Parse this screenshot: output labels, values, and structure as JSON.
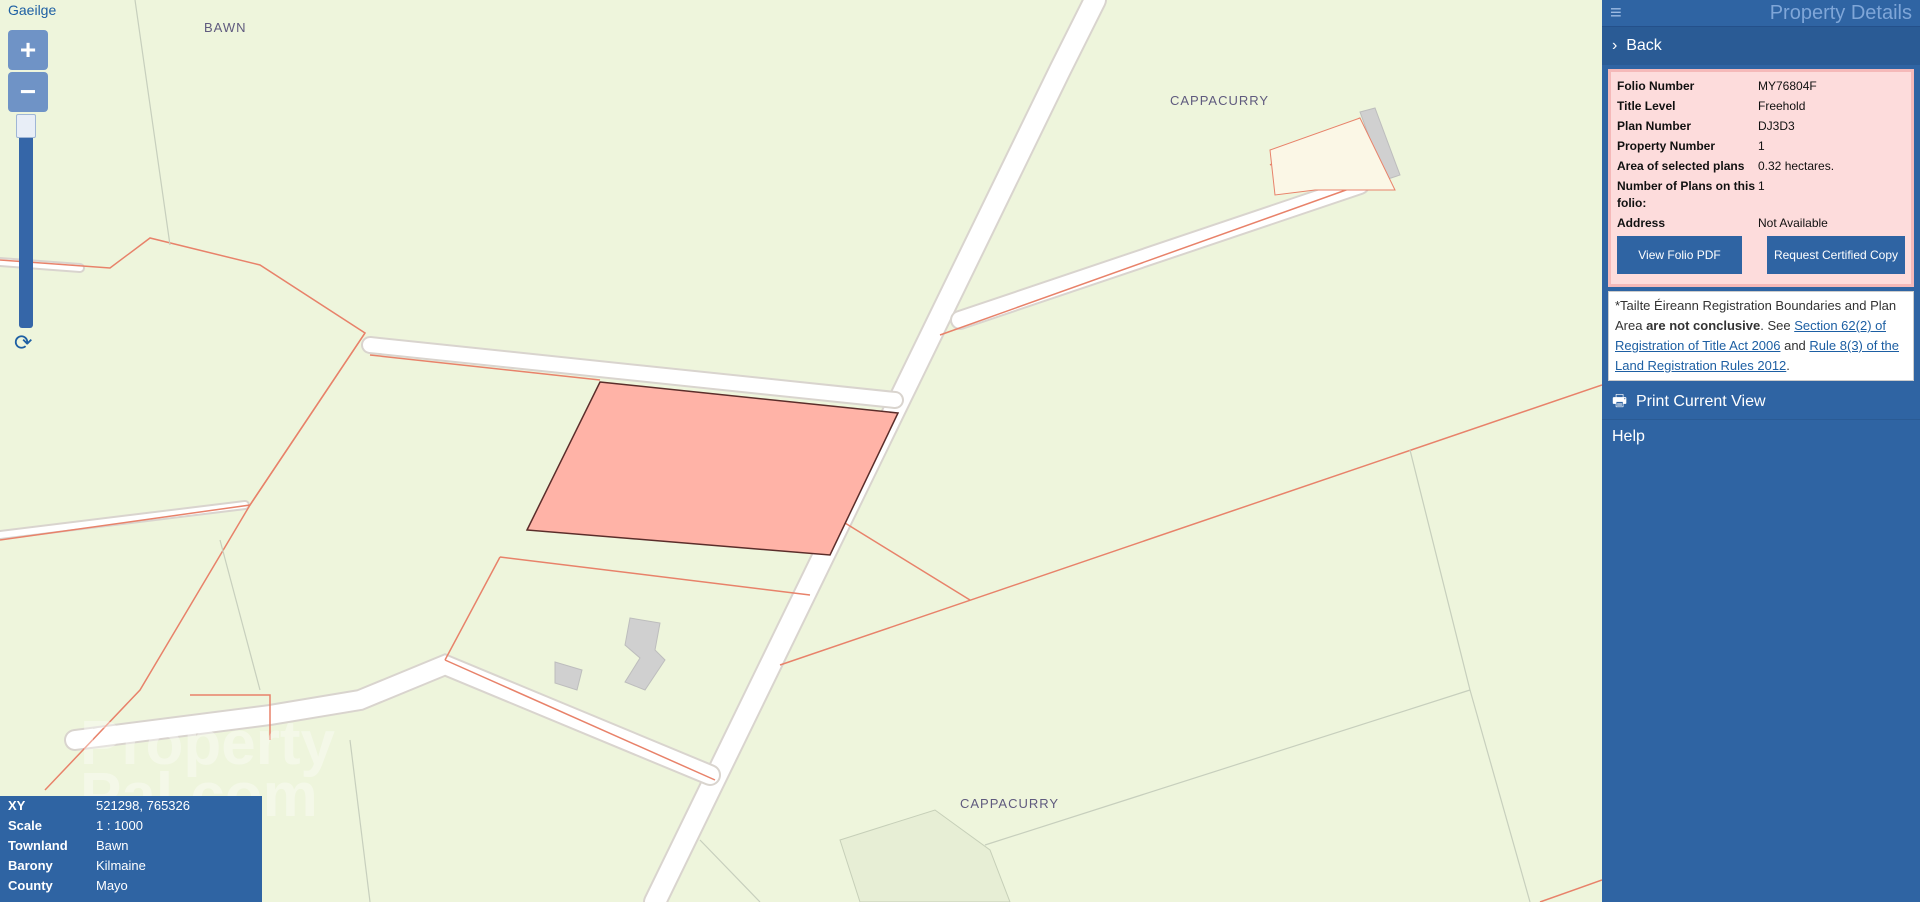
{
  "map": {
    "language_link": "Gaeilge",
    "zoom_in": "+",
    "zoom_out": "−",
    "refresh_icon": "⟳",
    "places": [
      {
        "name": "BAWN"
      },
      {
        "name": "CAPPACURRY"
      },
      {
        "name": "CAPPACURRY"
      }
    ],
    "watermark": "Property\nPal.com"
  },
  "info": {
    "rows": [
      {
        "key": "XY",
        "value": "521298, 765326"
      },
      {
        "key": "Scale",
        "value": "1 : 1000"
      },
      {
        "key": "Townland",
        "value": "Bawn"
      },
      {
        "key": "Barony",
        "value": "Kilmaine"
      },
      {
        "key": "County",
        "value": "Mayo"
      }
    ]
  },
  "panel": {
    "title": "Property Details",
    "menu_icon": "≡",
    "back_label": "Back",
    "back_icon": "›",
    "details": [
      {
        "key": "Folio Number",
        "value": "MY76804F"
      },
      {
        "key": "Title Level",
        "value": "Freehold"
      },
      {
        "key": "Plan Number",
        "value": "DJ3D3"
      },
      {
        "key": "Property Number",
        "value": "1"
      },
      {
        "key": "Area of selected plans",
        "value": "0.32 hectares."
      },
      {
        "key": "Number of Plans on this folio:",
        "value": "1"
      },
      {
        "key": "Address",
        "value": "Not Available"
      }
    ],
    "view_pdf": "View Folio PDF",
    "request_copy": "Request Certified Copy",
    "note": {
      "prefix": "*Tailte Éireann Registration Boundaries and Plan Area ",
      "bold": "are not conclusive",
      "mid": ". See ",
      "link1": "Section 62(2) of Registration of Title Act 2006",
      "and": " and ",
      "link2": "Rule 8(3) of the Land Registration Rules 2012",
      "end": "."
    },
    "print_label": "Print Current View",
    "print_icon": "🖶",
    "help_label": "Help"
  },
  "colors": {
    "panel_bg": "#2f64a3",
    "selected_parcel": "#ffb3a7",
    "boundary": "#e8826a",
    "map_bg": "#eef5dc"
  }
}
